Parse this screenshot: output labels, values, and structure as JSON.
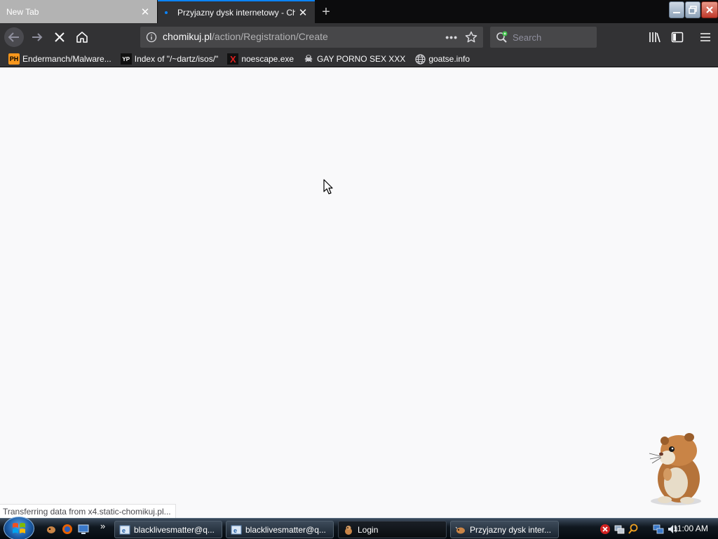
{
  "browser": {
    "tabs": [
      {
        "title": "New Tab",
        "active": false
      },
      {
        "title": "Przyjazny dysk internetowy - Ch",
        "active": true
      }
    ],
    "new_tab_icon": "plus-icon",
    "url": {
      "host": "chomikuj.pl",
      "path": "/action/Registration/Create"
    },
    "search_placeholder": "Search",
    "bookmarks": [
      {
        "label": "Endermanch/Malware...",
        "icon": "ph-logo-icon",
        "icon_text": "PH",
        "icon_color": "#f7971d"
      },
      {
        "label": "Index of \"/~dartz/isos/\"",
        "icon": "yp-logo-icon",
        "icon_text": "YP",
        "icon_color": "#ffffff"
      },
      {
        "label": "noescape.exe",
        "icon": "x-logo-icon",
        "icon_text": "X",
        "icon_color": "#e02020"
      },
      {
        "label": "GAY PORNO SEX XXX",
        "icon": "skull-icon",
        "icon_text": "☠",
        "icon_color": "#d7d7db"
      },
      {
        "label": "goatse.info",
        "icon": "globe-icon",
        "icon_text": "",
        "icon_color": "#d7d7db"
      }
    ],
    "status": "Transferring data from x4.static-chomikuj.pl..."
  },
  "taskbar": {
    "tasks": [
      {
        "label": "blacklivesmatter@q...",
        "icon": "ie-window-icon"
      },
      {
        "label": "blacklivesmatter@q...",
        "icon": "ie-window-icon"
      },
      {
        "label": "Login",
        "icon": "hamster-icon"
      },
      {
        "label": "Przyjazny dysk inter...",
        "icon": "firefox-window-icon"
      }
    ],
    "clock": "11:00 AM"
  },
  "colors": {
    "accent": "#0a84ff",
    "toolbar": "#323234",
    "tabstrip": "#0c0c0d",
    "content_bg": "#f9f9fa"
  }
}
